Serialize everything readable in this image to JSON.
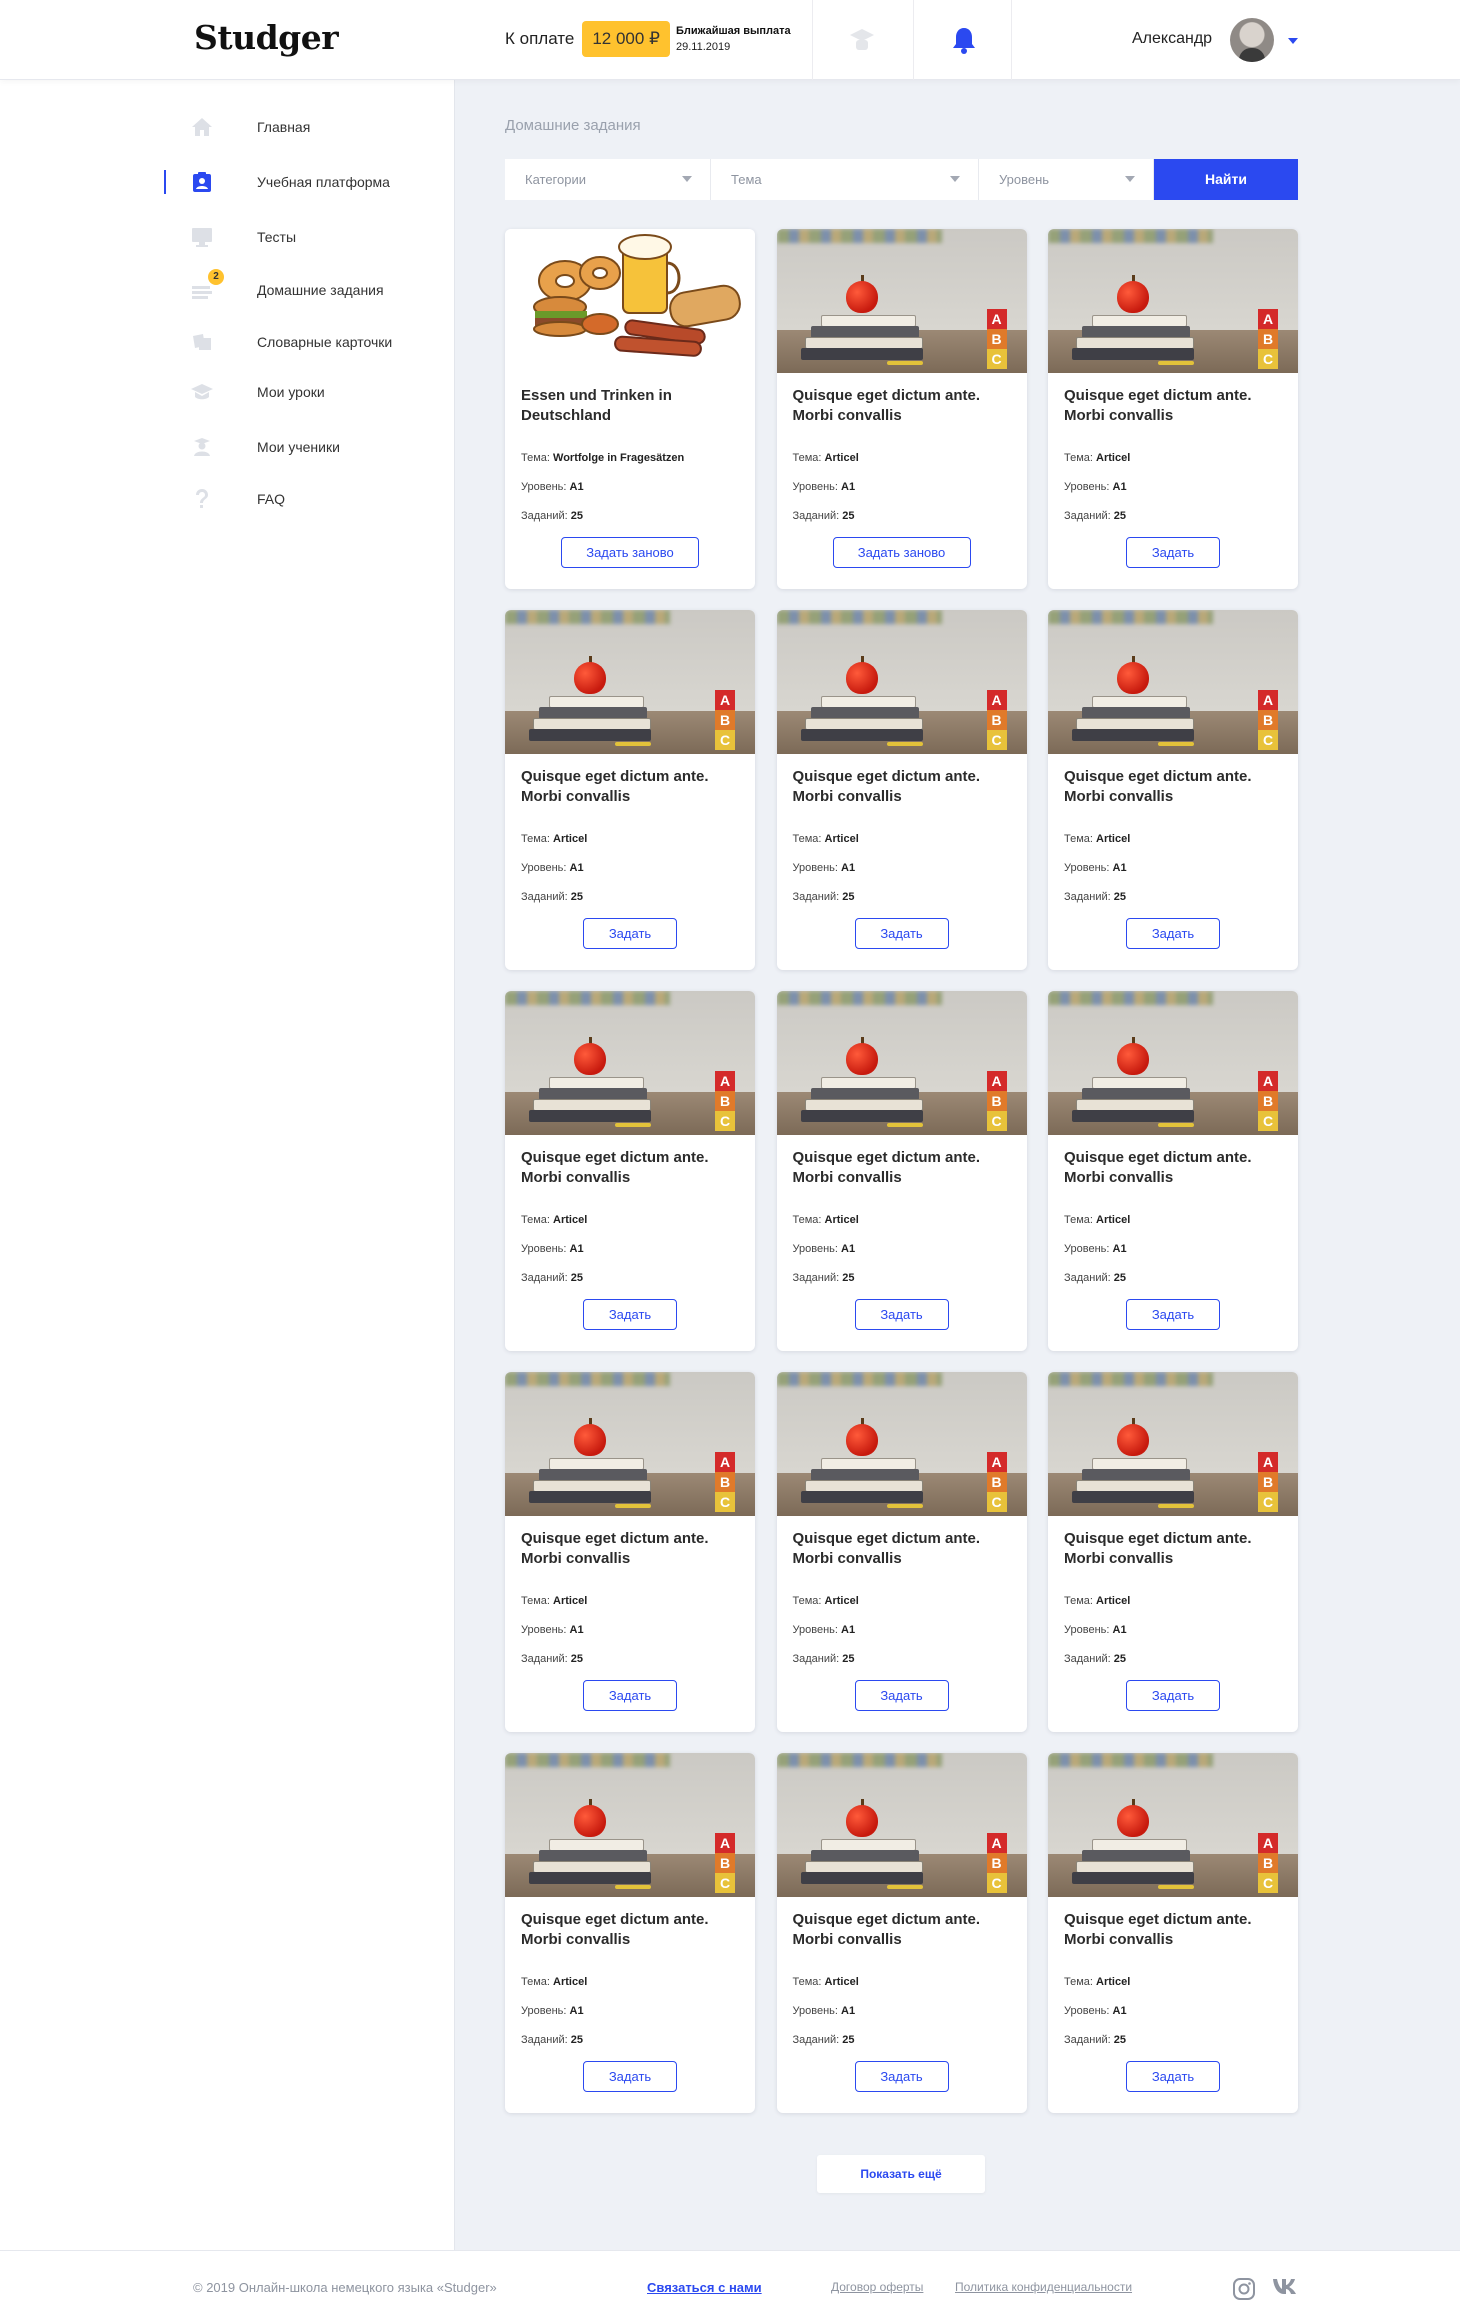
{
  "header": {
    "logo": "Studger",
    "pay_label": "К оплате",
    "pay_amount": "12 000 ₽",
    "payout_title": "Ближайшая выплата",
    "payout_date": "29.11.2019",
    "user_name": "Александр"
  },
  "sidebar": {
    "items": [
      {
        "label": "Главная",
        "icon": "home-icon"
      },
      {
        "label": "Учебная платформа",
        "icon": "clipboard-user-icon"
      },
      {
        "label": "Тесты",
        "icon": "monitor-icon"
      },
      {
        "label": "Домашние задания",
        "icon": "homework-icon",
        "badge": "2"
      },
      {
        "label": "Словарные карточки",
        "icon": "cards-icon"
      },
      {
        "label": "Мои уроки",
        "icon": "graduation-cap-icon"
      },
      {
        "label": "Мои ученики",
        "icon": "student-icon"
      },
      {
        "label": "FAQ",
        "icon": "question-icon"
      }
    ]
  },
  "main": {
    "title": "Домашние задания",
    "filters": {
      "category": "Категории",
      "topic": "Тема",
      "level": "Уровень",
      "search": "Найти"
    },
    "labels": {
      "topic": "Тема:",
      "level": "Уровень:",
      "tasks": "Заданий:"
    },
    "cards": [
      {
        "title": "Essen und Trinken in Deutschland",
        "topic": "Wortfolge in Fragesätzen",
        "level": "A1",
        "tasks": "25",
        "button": "Задать заново",
        "image": "food"
      },
      {
        "title": "Quisque eget dictum ante. Morbi convallis",
        "topic": "Articel",
        "level": "A1",
        "tasks": "25",
        "button": "Задать заново",
        "image": "books"
      },
      {
        "title": "Quisque eget dictum ante. Morbi convallis",
        "topic": "Articel",
        "level": "A1",
        "tasks": "25",
        "button": "Задать",
        "image": "books"
      },
      {
        "title": "Quisque eget dictum ante. Morbi convallis",
        "topic": "Articel",
        "level": "A1",
        "tasks": "25",
        "button": "Задать",
        "image": "books"
      },
      {
        "title": "Quisque eget dictum ante. Morbi convallis",
        "topic": "Articel",
        "level": "A1",
        "tasks": "25",
        "button": "Задать",
        "image": "books"
      },
      {
        "title": "Quisque eget dictum ante. Morbi convallis",
        "topic": "Articel",
        "level": "A1",
        "tasks": "25",
        "button": "Задать",
        "image": "books"
      },
      {
        "title": "Quisque eget dictum ante. Morbi convallis",
        "topic": "Articel",
        "level": "A1",
        "tasks": "25",
        "button": "Задать",
        "image": "books"
      },
      {
        "title": "Quisque eget dictum ante. Morbi convallis",
        "topic": "Articel",
        "level": "A1",
        "tasks": "25",
        "button": "Задать",
        "image": "books"
      },
      {
        "title": "Quisque eget dictum ante. Morbi convallis",
        "topic": "Articel",
        "level": "A1",
        "tasks": "25",
        "button": "Задать",
        "image": "books"
      },
      {
        "title": "Quisque eget dictum ante. Morbi convallis",
        "topic": "Articel",
        "level": "A1",
        "tasks": "25",
        "button": "Задать",
        "image": "books"
      },
      {
        "title": "Quisque eget dictum ante. Morbi convallis",
        "topic": "Articel",
        "level": "A1",
        "tasks": "25",
        "button": "Задать",
        "image": "books"
      },
      {
        "title": "Quisque eget dictum ante. Morbi convallis",
        "topic": "Articel",
        "level": "A1",
        "tasks": "25",
        "button": "Задать",
        "image": "books"
      },
      {
        "title": "Quisque eget dictum ante. Morbi convallis",
        "topic": "Articel",
        "level": "A1",
        "tasks": "25",
        "button": "Задать",
        "image": "books"
      },
      {
        "title": "Quisque eget dictum ante. Morbi convallis",
        "topic": "Articel",
        "level": "A1",
        "tasks": "25",
        "button": "Задать",
        "image": "books"
      },
      {
        "title": "Quisque eget dictum ante. Morbi convallis",
        "topic": "Articel",
        "level": "A1",
        "tasks": "25",
        "button": "Задать",
        "image": "books"
      }
    ],
    "show_more": "Показать ещё"
  },
  "footer": {
    "copyright": "© 2019 Онлайн-школа немецкого языка «Studger»",
    "contact": "Связаться с нами",
    "offer": "Договор оферты",
    "privacy": "Политика конфиденциальности"
  },
  "colors": {
    "accent": "#2b49f0",
    "highlight": "#ffc22e",
    "background": "#eef1f6"
  }
}
